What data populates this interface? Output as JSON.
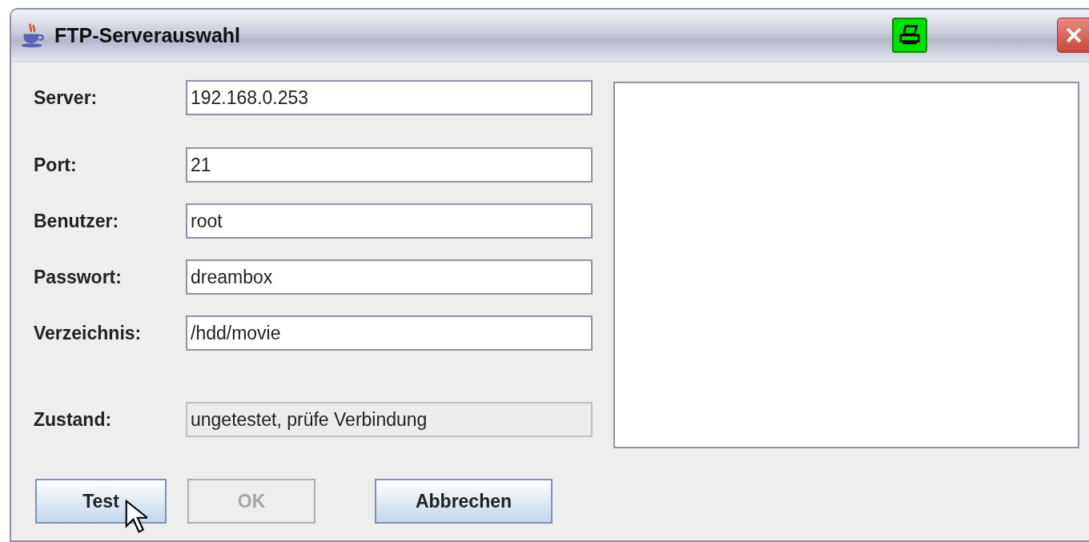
{
  "window": {
    "title": "FTP-Serverauswahl"
  },
  "fields": [
    {
      "label": "Server:",
      "value": "192.168.0.253",
      "disabled": false
    },
    {
      "label": "Port:",
      "value": "21",
      "disabled": false
    },
    {
      "label": "Benutzer:",
      "value": "root",
      "disabled": false
    },
    {
      "label": "Passwort:",
      "value": "dreambox",
      "disabled": false
    },
    {
      "label": "Verzeichnis:",
      "value": "/hdd/movie",
      "disabled": false
    },
    {
      "label": "Zustand:",
      "value": "ungetestet, prüfe Verbindung",
      "disabled": true
    }
  ],
  "buttons": [
    {
      "label": "Test",
      "disabled": false
    },
    {
      "label": "OK",
      "disabled": true
    },
    {
      "label": "Abbrechen",
      "disabled": false
    }
  ]
}
